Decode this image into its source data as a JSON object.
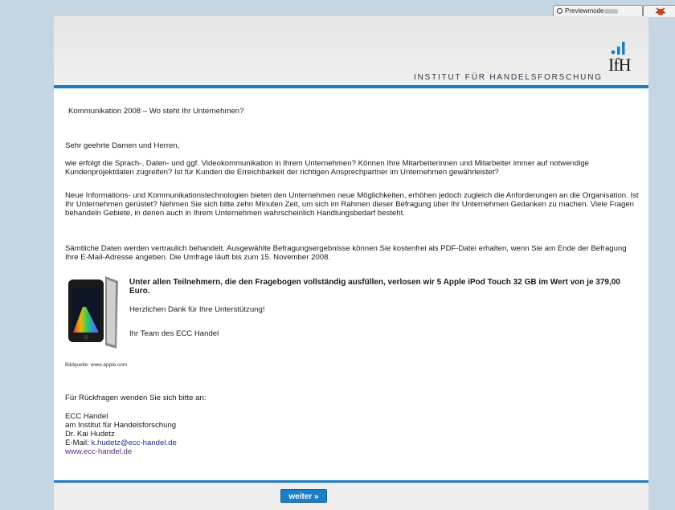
{
  "toolbar": {
    "preview_label": "Previewmode",
    "preview_grid": "▦▦▦"
  },
  "header": {
    "institute_name": "INSTITUT FÜR HANDELSFORSCHUNG",
    "logo_text": "IfH"
  },
  "letter": {
    "subject": "Kommunikation 2008 – Wo steht Ihr Unternehmen?",
    "greeting": "Sehr geehrte Damen und Herren,",
    "paragraph1": "wie erfolgt die Sprach-, Daten- und ggf. Videokommunikation in Ihrem Unternehmen? Können Ihre Mitarbeiterinnen und Mitarbeiter immer auf notwendige Kundenprojektdaten zugreifen? Ist für Kunden die Erreichbarkeit der richtigen Ansprechpartner im Unternehmen gewährleistet?",
    "paragraph2": "Neue Informations- und Kommunikationstechnologien bieten den Unternehmen neue Möglichkeiten, erhöhen jedoch zugleich die Anforderungen an die Organisation. Ist Ihr Unternehmen gerüstet? Nehmen Sie sich bitte zehn Minuten Zeit, um sich im Rahmen dieser Befragung über Ihr Unternehmen Gedanken zu machen. Viele Fragen behandeln Gebiete, in denen auch in Ihrem Unternehmen wahrscheinlich Handlungsbedarf besteht.",
    "paragraph3": "Sämtliche Daten werden vertraulich behandelt. Ausgewählte Befragungsergebnisse können Sie kostenfrei als PDF-Datei erhalten, wenn Sie am Ende der Befragung Ihre E-Mail-Adresse angeben. Die Umfrage läuft bis zum 15. November 2008.",
    "raffle": "Unter allen Teilnehmern, die den Fragebogen vollständig ausfüllen, verlosen wir 5 Apple iPod Touch 32 GB im Wert von je 379,00 Euro.",
    "thanks": "Herzlichen Dank für Ihre Unterstützung!",
    "signature": "Ihr Team des ECC Handel",
    "image_credit": "Bildquelle: www.apple.com",
    "contact_intro": "Für Rückfragen wenden Sie sich bitte an:",
    "contact_org": "ECC Handel",
    "contact_institute": "am Institut für Handelsforschung",
    "contact_person": "Dr. Kai Hudetz",
    "email_label": "E-Mail: ",
    "email": "k.hudetz@ecc-handel.de",
    "website": "www.ecc-handel.de"
  },
  "footer": {
    "next_button": "weiter »"
  },
  "colors": {
    "accent": "#1d7bbf",
    "background": "#c5d6e2",
    "link": "#1b2f8a"
  },
  "icons": [
    "magnifier-icon",
    "firebug-icon",
    "ifh-logo-icon",
    "ipod-image"
  ]
}
